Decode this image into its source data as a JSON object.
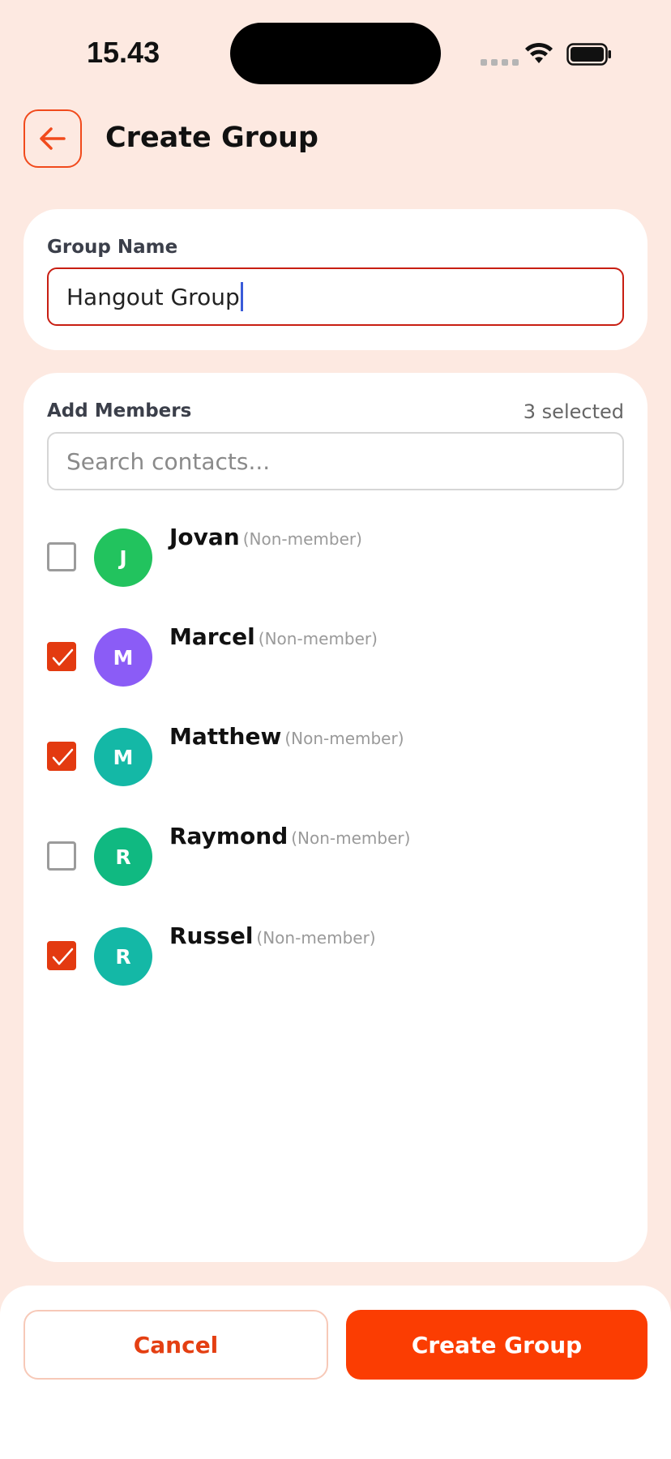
{
  "status_bar": {
    "time": "15.43"
  },
  "header": {
    "title": "Create Group"
  },
  "group_name": {
    "label": "Group Name",
    "value": "Hangout Group"
  },
  "members": {
    "label": "Add Members",
    "selected_count": "3 selected",
    "search_placeholder": "Search contacts...",
    "contacts": [
      {
        "name": "Jovan",
        "tag": "(Non-member)",
        "initial": "J",
        "checked": false,
        "avatar_color": "#22c35e"
      },
      {
        "name": "Marcel",
        "tag": "(Non-member)",
        "initial": "M",
        "checked": true,
        "avatar_color": "#8b5cf6"
      },
      {
        "name": "Matthew",
        "tag": "(Non-member)",
        "initial": "M",
        "checked": true,
        "avatar_color": "#14b8a6"
      },
      {
        "name": "Raymond",
        "tag": "(Non-member)",
        "initial": "R",
        "checked": false,
        "avatar_color": "#10b981"
      },
      {
        "name": "Russel",
        "tag": "(Non-member)",
        "initial": "R",
        "checked": true,
        "avatar_color": "#14b8a6"
      }
    ]
  },
  "actions": {
    "cancel_label": "Cancel",
    "create_label": "Create Group"
  },
  "colors": {
    "accent": "#fb3d02",
    "background": "#fde9e1"
  }
}
